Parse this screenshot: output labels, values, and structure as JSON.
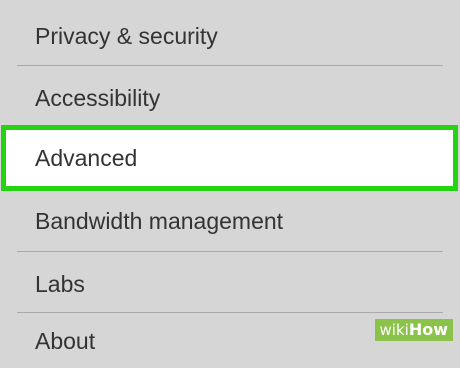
{
  "menu": {
    "items": [
      {
        "label": "Privacy & security"
      },
      {
        "label": "Accessibility"
      },
      {
        "label": "Advanced",
        "selected": true
      },
      {
        "label": "Bandwidth management"
      },
      {
        "label": "Labs"
      },
      {
        "label": "About"
      }
    ]
  },
  "watermark": {
    "part1": "wiki",
    "part2": "How"
  },
  "colors": {
    "background": "#d6d6d6",
    "highlight_border": "#25d312",
    "highlight_fill": "#ffffff",
    "text": "#333333",
    "divider": "#a9a9a9"
  }
}
